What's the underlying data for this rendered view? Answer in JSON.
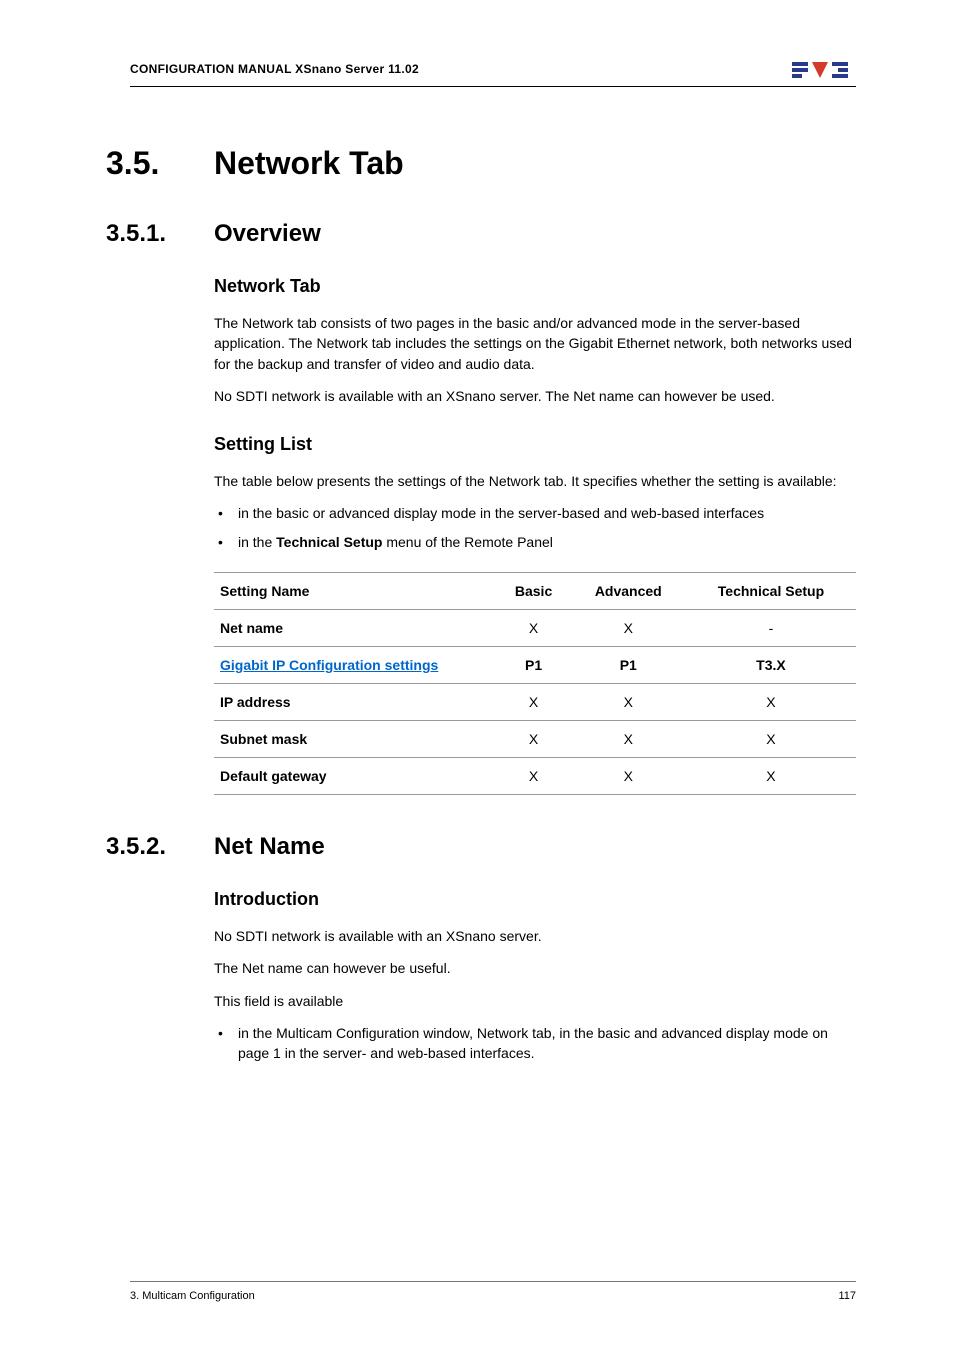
{
  "header": {
    "doc_title": "CONFIGURATION MANUAL  XSnano Server 11.02"
  },
  "section": {
    "h1_num": "3.5.",
    "h1_text": "Network Tab",
    "s1": {
      "num": "3.5.1.",
      "title": "Overview",
      "h3a": "Network Tab",
      "p1": "The Network tab consists of two pages in the basic and/or advanced mode in the server-based application. The Network tab includes the settings on the  Gigabit Ethernet network, both networks used for the backup and transfer of video and audio data.",
      "p2": "No SDTI network is available with an XSnano server. The Net name can however be used.",
      "h3b": "Setting List",
      "p3": "The table below presents the settings of the Network tab. It specifies whether the setting is available:",
      "b1": "in the basic or advanced display mode in the server-based and web-based interfaces",
      "b2_pre": "in the ",
      "b2_bold": "Technical  Setup",
      "b2_post": " menu of the Remote Panel",
      "table": {
        "headers": [
          "Setting Name",
          "Basic",
          "Advanced",
          "Technical Setup"
        ],
        "rows": [
          {
            "name": "Net name",
            "link": false,
            "basic": "X",
            "adv": "X",
            "tech": "-"
          },
          {
            "name": "Gigabit IP Configuration settings",
            "link": true,
            "basic": "P1",
            "adv": "P1",
            "tech": "T3.X"
          },
          {
            "name": "IP address",
            "link": false,
            "basic": "X",
            "adv": "X",
            "tech": "X"
          },
          {
            "name": "Subnet mask",
            "link": false,
            "basic": "X",
            "adv": "X",
            "tech": "X"
          },
          {
            "name": "Default gateway",
            "link": false,
            "basic": "X",
            "adv": "X",
            "tech": "X"
          }
        ]
      }
    },
    "s2": {
      "num": "3.5.2.",
      "title": "Net Name",
      "h3a": "Introduction",
      "p1": "No SDTI network is available with an XSnano server.",
      "p2": "The Net name can however be useful.",
      "p3": "This field is available",
      "b1": "in the Multicam Configuration window, Network tab, in the basic and advanced display mode on page 1 in the server- and web-based interfaces."
    }
  },
  "footer": {
    "left": "3. Multicam Configuration",
    "right": "117"
  }
}
